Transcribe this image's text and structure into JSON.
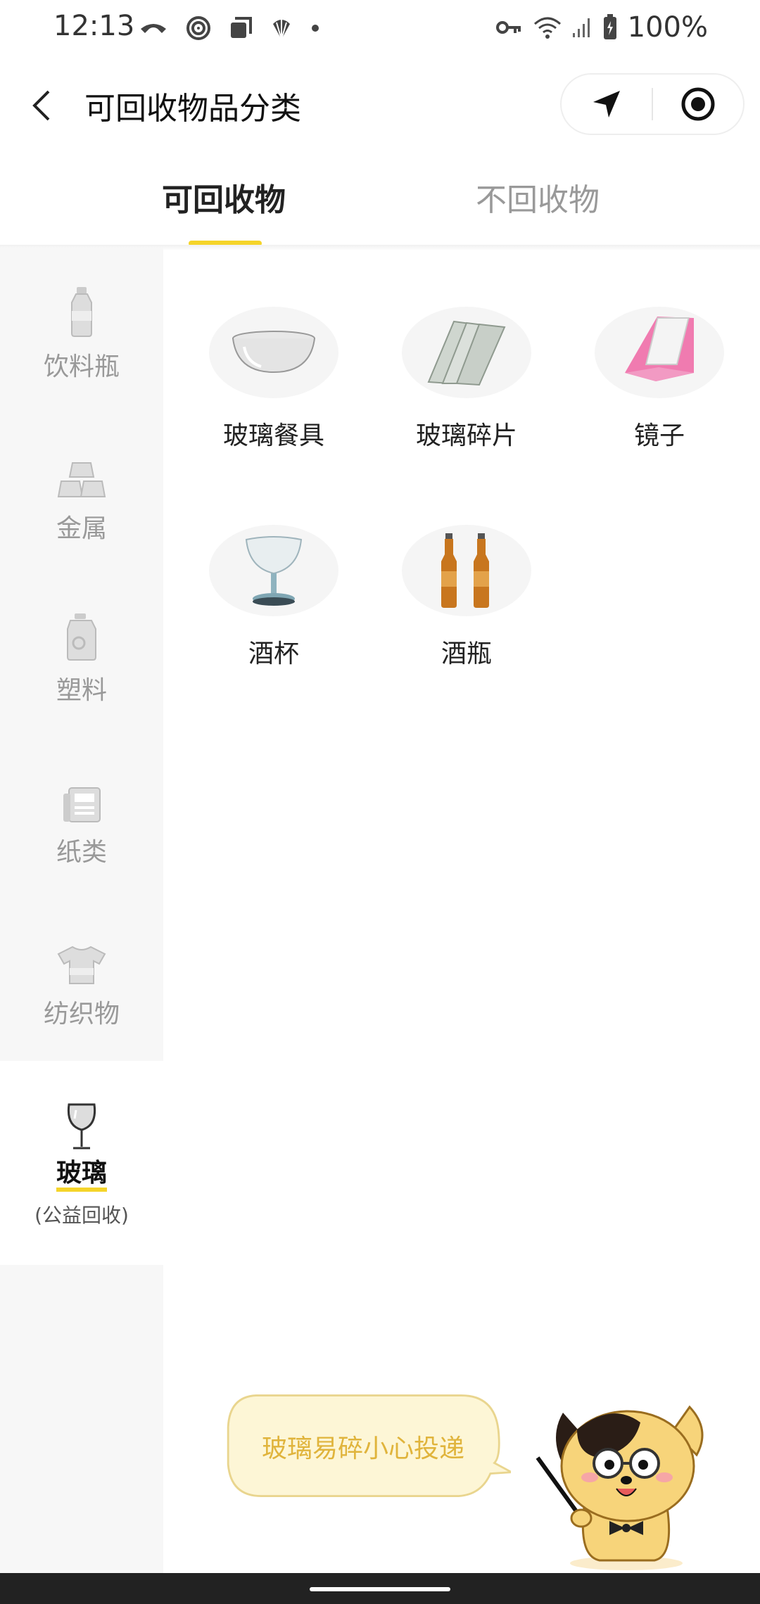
{
  "status_bar": {
    "time": "12:13",
    "battery": "100%"
  },
  "nav": {
    "title": "可回收物品分类"
  },
  "tabs": [
    {
      "label": "可回收物",
      "active": true
    },
    {
      "label": "不回收物",
      "active": false
    }
  ],
  "categories": [
    {
      "label": "饮料瓶",
      "icon": "bottle-icon"
    },
    {
      "label": "金属",
      "icon": "metal-ingots-icon"
    },
    {
      "label": "塑料",
      "icon": "plastic-jug-icon"
    },
    {
      "label": "纸类",
      "icon": "newspaper-icon"
    },
    {
      "label": "纺织物",
      "icon": "tshirt-icon"
    },
    {
      "label": "玻璃",
      "sublabel": "(公益回收)",
      "icon": "wine-glass-icon",
      "active": true
    }
  ],
  "items": [
    {
      "label": "玻璃餐具",
      "icon": "glass-bowl-icon"
    },
    {
      "label": "玻璃碎片",
      "icon": "glass-shards-icon"
    },
    {
      "label": "镜子",
      "icon": "mirror-icon"
    },
    {
      "label": "酒杯",
      "icon": "goblet-icon"
    },
    {
      "label": "酒瓶",
      "icon": "beer-bottles-icon"
    }
  ],
  "tip": {
    "text": "玻璃易碎小心投递"
  },
  "colors": {
    "accent": "#f5d42a",
    "tip_text": "#e0b43c",
    "sidebar_bg": "#f7f7f7"
  }
}
